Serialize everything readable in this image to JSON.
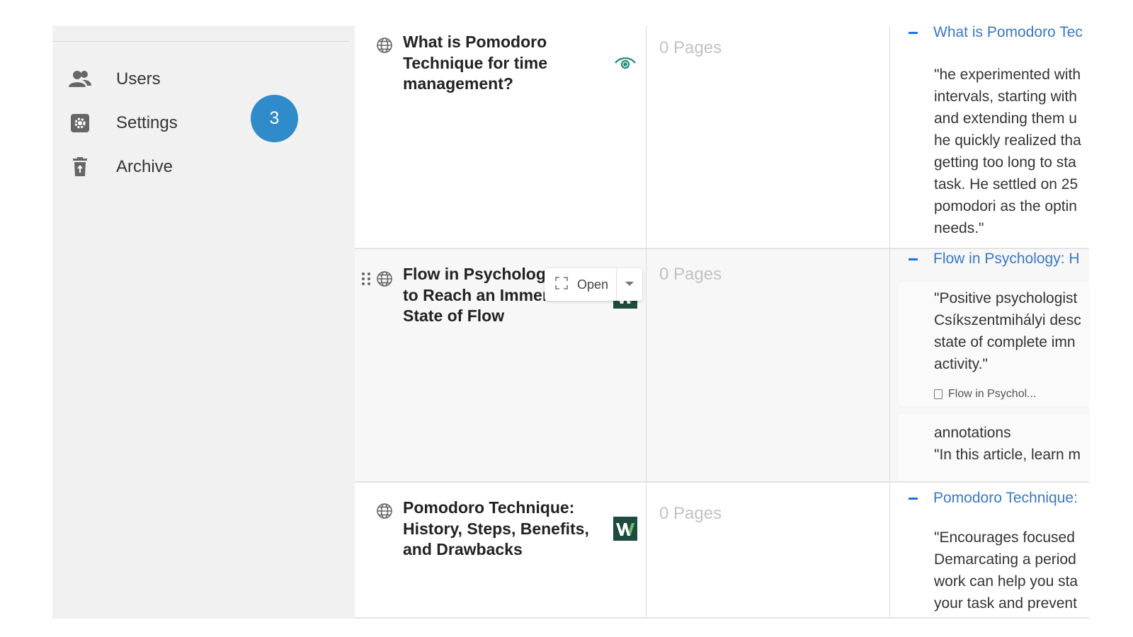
{
  "sidebar": {
    "items": [
      {
        "label": "Users",
        "icon": "users-icon"
      },
      {
        "label": "Settings",
        "icon": "settings-icon"
      },
      {
        "label": "Archive",
        "icon": "trash-icon"
      }
    ],
    "badge": "3"
  },
  "colors": {
    "accent": "#2f8bc9",
    "link": "#3a78c4",
    "eye_icon": "#1e8a7a",
    "w_logo_bg": "#1f4a3f"
  },
  "rows": [
    {
      "title_lines": [
        "What is Pomodoro",
        "Technique for time",
        "management?"
      ],
      "pages": "0 Pages",
      "annotation_title": "What is Pomodoro Tec",
      "quote_lines": [
        "\"he experimented with",
        "intervals, starting with",
        "and extending them u",
        "he quickly realized tha",
        "getting too long to sta",
        "task. He settled on 25",
        "pomodori as the optin",
        "needs.\""
      ]
    },
    {
      "title_lines": [
        "Flow in Psychology",
        "to Reach an Immersed",
        "State of Flow"
      ],
      "pages": "0 Pages",
      "annotation_title": "Flow in Psychology: H",
      "quote_lines": [
        "\"Positive psychologist",
        "Csíkszentmihályi desc",
        "state of complete imn",
        "activity.\""
      ],
      "source": "Flow in Psychol...",
      "annotations_label": "annotations",
      "annotations_quote": "\"In this article, learn m"
    },
    {
      "title_lines": [
        "Pomodoro Technique:",
        "History, Steps, Benefits,",
        "and Drawbacks"
      ],
      "pages": "0 Pages",
      "annotation_title": "Pomodoro Technique:",
      "quote_lines": [
        "\"Encourages focused",
        "Demarcating a period",
        "work can help you sta",
        "your task and prevent"
      ]
    }
  ],
  "popover": {
    "open_label": "Open"
  }
}
